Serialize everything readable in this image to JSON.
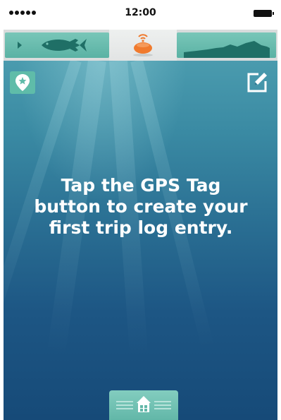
{
  "status_bar": {
    "time": "12:00",
    "signal_icon": "signal-dots-icon",
    "battery_icon": "battery-icon"
  },
  "tabs": [
    {
      "name": "fish",
      "icon": "fish-icon",
      "selected": false
    },
    {
      "name": "sonar",
      "icon": "sonar-device-icon",
      "selected": true
    },
    {
      "name": "depth",
      "icon": "depth-profile-icon",
      "selected": false
    }
  ],
  "toolbar": {
    "gps_tag_icon": "gps-tag-icon",
    "edit_icon": "edit-icon"
  },
  "message": "Tap the GPS Tag button to create your first trip log entry.",
  "bottom_nav": {
    "home_icon": "home-icon"
  },
  "colors": {
    "accent_teal": "#5fbca9",
    "sonar_orange": "#f07a2d",
    "ocean_top": "#4a9bae",
    "ocean_bottom": "#164a78"
  }
}
